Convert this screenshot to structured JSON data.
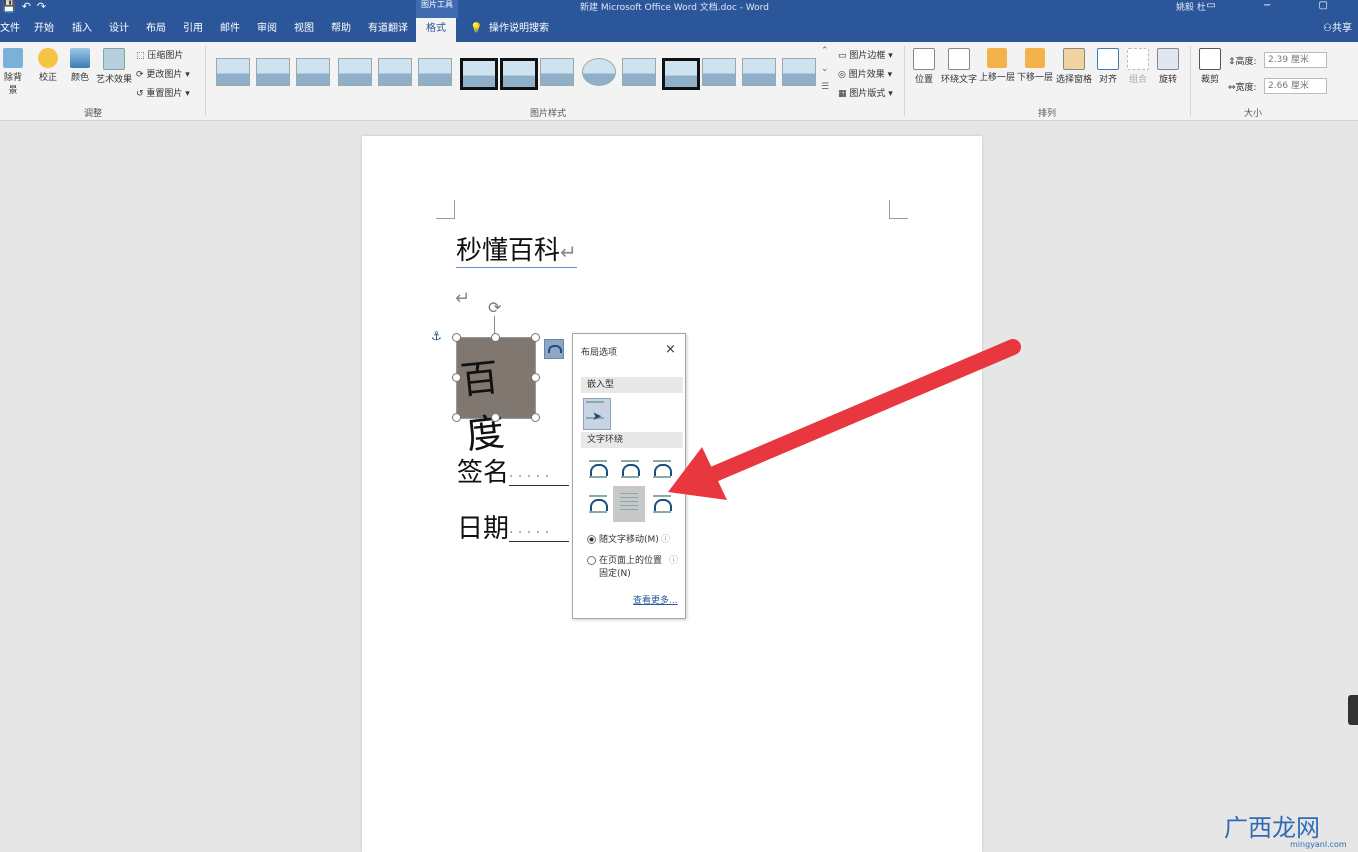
{
  "titlebar": {
    "context_tab": "图片工具",
    "title": "新建 Microsoft Office Word 文档.doc - Word",
    "user": "姚毅 杜"
  },
  "tabs": [
    "文件",
    "开始",
    "插入",
    "设计",
    "布局",
    "引用",
    "邮件",
    "审阅",
    "视图",
    "帮助",
    "有道翻译",
    "格式"
  ],
  "search_hint": "操作说明搜索",
  "share": "共享",
  "ribbon": {
    "adjust": {
      "remove_bg": "除背景",
      "corrections": "校正",
      "color": "颜色",
      "artistic": "艺术效果",
      "compress": "压缩图片",
      "change": "更改图片",
      "reset": "重置图片",
      "label": "调整"
    },
    "styles": {
      "label": "图片样式",
      "border": "图片边框",
      "effects": "图片效果",
      "layout": "图片版式"
    },
    "arrange": {
      "label": "排列",
      "position": "位置",
      "wrap_text": "环绕文字",
      "bring_forward": "上移一层",
      "send_backward": "下移一层",
      "selection_pane": "选择窗格",
      "align": "对齐",
      "group": "组合",
      "rotate": "旋转"
    },
    "size": {
      "label": "大小",
      "crop": "裁剪",
      "height_label": "高度:",
      "height_value": "2.39 厘米",
      "width_label": "宽度:",
      "width_value": "2.66 厘米"
    }
  },
  "document": {
    "heading": "秒懂百科",
    "signature_label": "签名",
    "date_label": "日期",
    "signature_image_text": "百度"
  },
  "layout_popup": {
    "title": "布局选项",
    "close": "×",
    "inline_section": "嵌入型",
    "wrap_section": "文字环绕",
    "move_with_text": "随文字移动(M)",
    "fix_position_line1": "在页面上的位置",
    "fix_position_line2": "固定(N)",
    "see_more": "查看更多..."
  },
  "watermark": {
    "brand": "广西龙网",
    "url": "mingyanl.com"
  },
  "colors": {
    "ribbon_blue": "#2b579a",
    "arrow_red": "#e8373f"
  }
}
